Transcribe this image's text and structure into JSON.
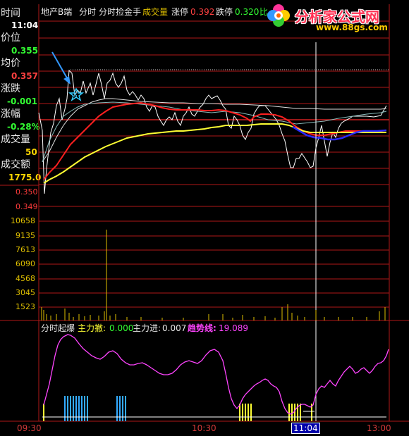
{
  "sidebar": {
    "time_label": "时间",
    "time_value": "11:04",
    "price_label": "价位",
    "price_value": "0.355",
    "avg_label": "均价",
    "avg_value": "0.357",
    "change_label": "涨跌",
    "change_value": "-0.001",
    "pct_label": "涨幅",
    "pct_value": "-0.28%",
    "volume_label": "成交量",
    "volume_value": "50",
    "amount_label": "成交额",
    "amount_value": "1775.0"
  },
  "header": {
    "stock_name": "地产B端",
    "indicator1": "分时",
    "indicator2": "分时捡金手",
    "vol_label": "成交量",
    "limit_up_label": "涨停",
    "limit_up_value": "0.392",
    "limit_down_label": "跌停",
    "limit_down_value": "0.320",
    "trailing_text": "比"
  },
  "price_axis": [
    "0.350",
    "0.349"
  ],
  "volume_axis": [
    "10658",
    "9135",
    "7613",
    "6090",
    "4568",
    "3045",
    "1523"
  ],
  "bottom_panel": {
    "title": "分时起爆",
    "main_out_label": "主力撤:",
    "main_out_value": "0.000",
    "main_in_label": "主力进:",
    "main_in_value": "0.007",
    "trend_label": "趋势线:",
    "trend_value": "19.089"
  },
  "time_axis": [
    "09:30",
    "10:30",
    "11:04",
    "13:00"
  ],
  "watermark": {
    "title": "分析家公式网",
    "url": "www.88gs.com"
  },
  "signal_marker": "S",
  "colors": {
    "grid": "#b01818",
    "price_line": "#ffffff",
    "avg_line": "#ffff33",
    "ma_red": "#ff2020",
    "trend_line": "#ff44ff",
    "main_in_bars": "#ffff33",
    "main_out_bars": "#33aaff",
    "arrow": "#3399ff",
    "cursor": "#ffffff"
  }
}
